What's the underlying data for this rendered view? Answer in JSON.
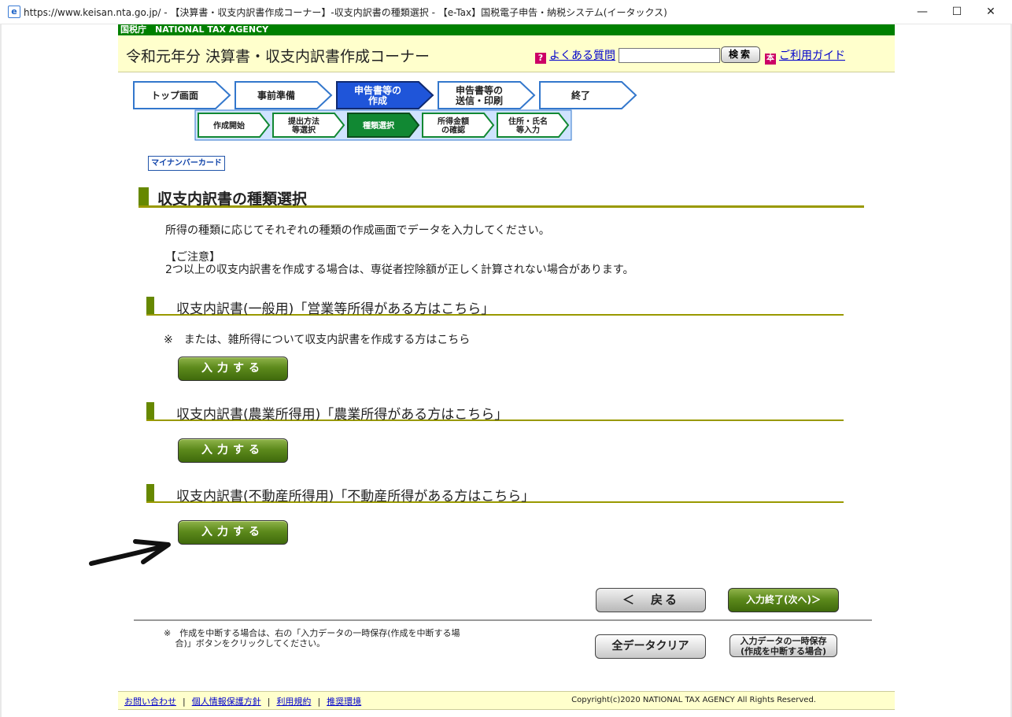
{
  "window": {
    "title": "https://www.keisan.nta.go.jp/ - 【決算書・収支内訳書作成コーナー】-収支内訳書の種類選択 - 【e-Tax】国税電子申告・納税システム(イータックス)",
    "minimize": "—",
    "maximize": "☐",
    "close": "✕",
    "browser_icon": "ie-icon"
  },
  "agency": {
    "label": "国税庁　NATIONAL TAX AGENCY"
  },
  "header": {
    "title": "令和元年分 決算書・収支内訳書作成コーナー",
    "faq_link": "よくある質問",
    "faq_icon": "?",
    "search_placeholder": "",
    "search_button": "検索",
    "guide_link": "ご利用ガイド",
    "guide_icon": "本"
  },
  "steps": {
    "main": [
      {
        "label": "トップ画面",
        "state": "done"
      },
      {
        "label": "事前準備",
        "state": "done"
      },
      {
        "label": "申告書等の\n作成",
        "state": "current"
      },
      {
        "label": "申告書等の\n送信・印刷",
        "state": "todo"
      },
      {
        "label": "終了",
        "state": "todo"
      }
    ],
    "sub": [
      {
        "label": "作成開始",
        "state": "done"
      },
      {
        "label": "提出方法\n等選択",
        "state": "done"
      },
      {
        "label": "種類選択",
        "state": "current"
      },
      {
        "label": "所得金額\nの確認",
        "state": "todo"
      },
      {
        "label": "住所・氏名\n等入力",
        "state": "todo"
      }
    ]
  },
  "mynumber_badge": "マイナンバーカード",
  "page": {
    "heading": "収支内訳書の種類選択",
    "intro": "所得の種類に応じてそれぞれの種類の作成画面でデータを入力してください。",
    "caution_title": "【ご注意】",
    "caution_text": "2つ以上の収支内訳書を作成する場合は、専従者控除額が正しく計算されない場合があります。"
  },
  "sections": [
    {
      "heading": "収支内訳書(一般用)「営業等所得がある方はこちら」",
      "note": "※　または、雑所得について収支内訳書を作成する方はこちら",
      "button": "入力する"
    },
    {
      "heading": "収支内訳書(農業所得用)「農業所得がある方はこちら」",
      "button": "入力する"
    },
    {
      "heading": "収支内訳書(不動産所得用)「不動産所得がある方はこちら」",
      "button": "入力する"
    }
  ],
  "nav": {
    "back": "＜　戻る",
    "next": "入力終了(次へ)＞"
  },
  "suspend": {
    "note_line1": "※　作成を中断する場合は、右の「入力データの一時保存(作成を中断する場",
    "note_line2": "　 合)」ボタンをクリックしてください。",
    "clear_button": "全データクリア",
    "save_line1": "入力データの一時保存",
    "save_line2": "(作成を中断する場合)"
  },
  "footer": {
    "links": [
      "お問い合わせ",
      "個人情報保護方針",
      "利用規約",
      "推奨環境"
    ],
    "copyright": "Copyright(c)2020 NATIONAL TAX AGENCY All Rights Reserved."
  },
  "colors": {
    "agency_bar": "#008000",
    "header_bg": "#ffffcc",
    "step_done": "#ffffff",
    "step_border": "#3377cc",
    "step_current": "#1f55d9",
    "sub_current": "#118833",
    "section_bar": "#668800",
    "button_green": "#5d8a1c"
  }
}
